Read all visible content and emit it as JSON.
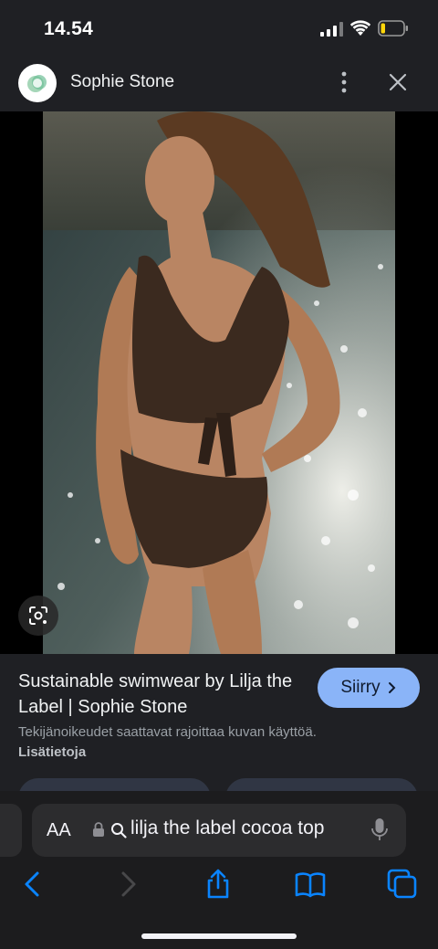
{
  "status_bar": {
    "time": "14.54"
  },
  "header": {
    "site_name": "Sophie Stone"
  },
  "image": {
    "alt": "Woman in dark brown wrap bikini by the sea"
  },
  "info": {
    "title": "Sustainable swimwear by Lilja the Label | Sophie Stone",
    "visit_label": "Siirry",
    "copyright_text": "Tekijänoikeudet saattavat rajoittaa kuvan käyttöä.",
    "learn_more": "Lisätietoja"
  },
  "browser": {
    "aa_label": "AA",
    "url_text": "lilja the label cocoa top"
  },
  "colors": {
    "accent": "#8ab4f8",
    "background": "#1f2024",
    "toolbar": "#1c1c1e",
    "link_blue": "#0a84ff"
  }
}
